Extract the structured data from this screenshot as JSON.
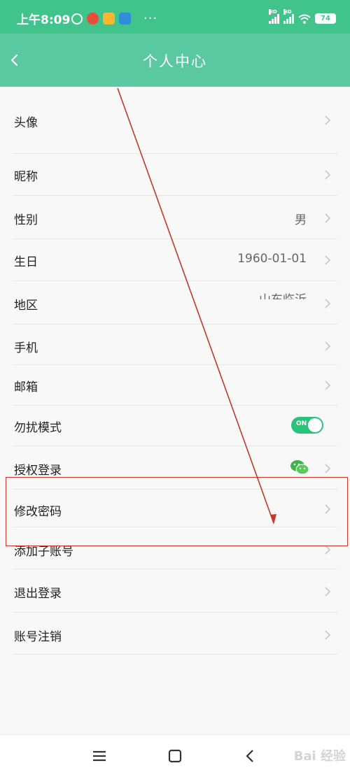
{
  "status_bar": {
    "time": "上午8:09",
    "dots": "···",
    "hd_label": "HD",
    "battery": "74"
  },
  "header": {
    "title": "个人中心"
  },
  "rows": [
    {
      "label": "头像",
      "value": ""
    },
    {
      "label": "昵称",
      "value": ""
    },
    {
      "label": "性别",
      "value": "男"
    },
    {
      "label": "生日",
      "value": "1960-01-01"
    },
    {
      "label": "地区",
      "value": "山东临沂"
    },
    {
      "label": "手机",
      "value": ""
    },
    {
      "label": "邮箱",
      "value": ""
    },
    {
      "label": "勿扰模式",
      "value": ""
    },
    {
      "label": "授权登录",
      "value": ""
    },
    {
      "label": "修改密码",
      "value": ""
    },
    {
      "label": "添加子账号",
      "value": ""
    },
    {
      "label": "退出登录",
      "value": ""
    },
    {
      "label": "账号注销",
      "value": ""
    }
  ],
  "dnd_toggle": {
    "state_label": "ON",
    "on": true
  },
  "icons": {
    "back": "back-arrow-icon",
    "chevron": "chevron-right-icon",
    "wechat": "wechat-icon",
    "menu": "menu-icon",
    "home": "home-icon",
    "nav_back": "nav-back-icon"
  },
  "colors": {
    "status_bar": "#41c38c",
    "header": "#5ac8a0",
    "toggle_on": "#2bc27a",
    "highlight": "#d2342d"
  },
  "watermark": "Bai 经验"
}
